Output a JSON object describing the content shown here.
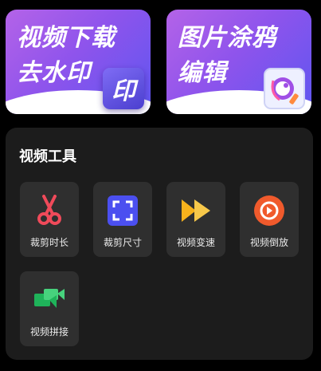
{
  "banners": [
    {
      "title_line1": "视频下载",
      "title_line2": "去水印",
      "badge_text": "印",
      "badge_icon": "stamp-icon"
    },
    {
      "title_line1": "图片涂鸦",
      "title_line2": "编辑",
      "badge_icon": "paint-brush-icon"
    }
  ],
  "panel": {
    "title": "视频工具",
    "tools": [
      {
        "label": "裁剪时长",
        "icon": "scissors-icon"
      },
      {
        "label": "裁剪尺寸",
        "icon": "crop-frame-icon"
      },
      {
        "label": "视频变速",
        "icon": "fast-forward-icon"
      },
      {
        "label": "视频倒放",
        "icon": "reverse-play-icon"
      },
      {
        "label": "视频拼接",
        "icon": "video-merge-icon"
      }
    ]
  },
  "colors": {
    "background": "#000000",
    "panel": "#1c1c1c",
    "tile": "#2f2f2f",
    "banner_gradient_start": "#b463e8",
    "banner_gradient_end": "#5e56f0",
    "scissors_red": "#f04a5a",
    "crop_blue": "#4b4ff0",
    "speed_yellow": "#f7b21c",
    "reverse_orange": "#f05a2c",
    "merge_green": "#1fb35a"
  }
}
